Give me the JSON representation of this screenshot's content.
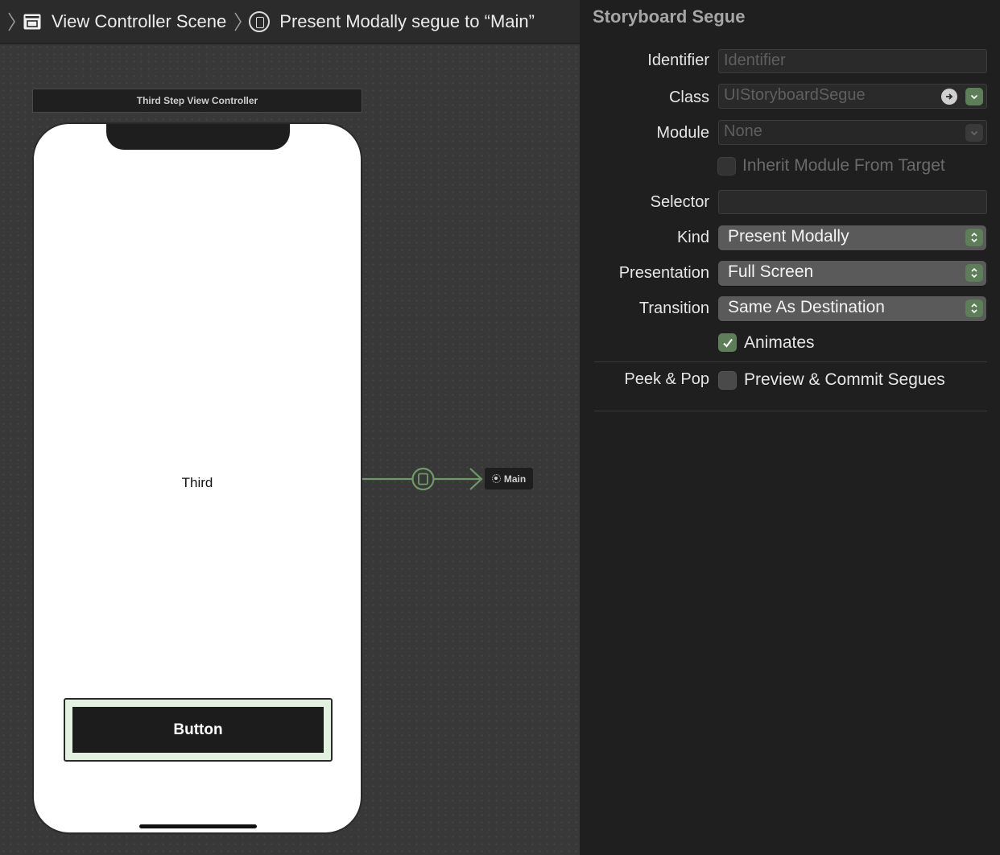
{
  "breadcrumb": {
    "scene": "View Controller Scene",
    "segue": "Present Modally segue to “Main”"
  },
  "canvas": {
    "scene_title": "Third Step View Controller",
    "label_text": "Third",
    "button_label": "Button",
    "segue_destination": "Main"
  },
  "inspector": {
    "section_title": "Storyboard Segue",
    "identifier": {
      "label": "Identifier",
      "value": "",
      "placeholder": "Identifier"
    },
    "class": {
      "label": "Class",
      "value": "UIStoryboardSegue"
    },
    "module": {
      "label": "Module",
      "value": "None"
    },
    "inherit_module": {
      "label": "Inherit Module From Target",
      "checked": false
    },
    "selector": {
      "label": "Selector",
      "value": ""
    },
    "kind": {
      "label": "Kind",
      "value": "Present Modally"
    },
    "presentation": {
      "label": "Presentation",
      "value": "Full Screen"
    },
    "transition": {
      "label": "Transition",
      "value": "Same As Destination"
    },
    "animates": {
      "label": "Animates",
      "checked": true
    },
    "peek_pop": {
      "label": "Peek & Pop",
      "option": "Preview & Commit Segues",
      "checked": false
    }
  },
  "colors": {
    "accent_green": "#5d7e59",
    "segue_line": "#6f9a67",
    "canvas_bg": "#383838",
    "inspector_bg": "#1f1f1f"
  }
}
